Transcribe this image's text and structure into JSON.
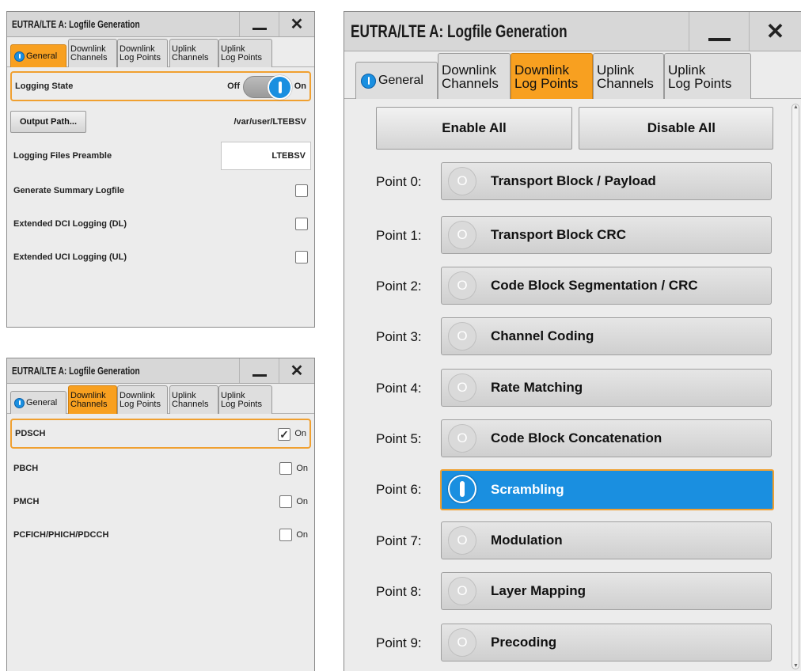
{
  "window_title": "EUTRA/LTE A: Logfile Generation",
  "tabs": [
    {
      "l1": "General",
      "l2": ""
    },
    {
      "l1": "Downlink",
      "l2": "Channels"
    },
    {
      "l1": "Downlink",
      "l2": "Log Points"
    },
    {
      "l1": "Uplink",
      "l2": "Channels"
    },
    {
      "l1": "Uplink",
      "l2": "Log Points"
    }
  ],
  "general": {
    "logging_state_label": "Logging State",
    "off_label": "Off",
    "on_label": "On",
    "logging_state_on": true,
    "output_path_button": "Output Path...",
    "output_path_value": "/var/user/LTEBSV",
    "preamble_label": "Logging Files Preamble",
    "preamble_value": "LTEBSV",
    "checks": [
      {
        "label": "Generate Summary Logfile",
        "checked": false
      },
      {
        "label": "Extended DCI Logging (DL)",
        "checked": false
      },
      {
        "label": "Extended UCI Logging (UL)",
        "checked": false
      }
    ]
  },
  "dl_channels": {
    "items": [
      {
        "label": "PDSCH",
        "on_label": "On",
        "checked": true
      },
      {
        "label": "PBCH",
        "on_label": "On",
        "checked": false
      },
      {
        "label": "PMCH",
        "on_label": "On",
        "checked": false
      },
      {
        "label": "PCFICH/PHICH/PDCCH",
        "on_label": "On",
        "checked": false
      }
    ]
  },
  "dl_log_points": {
    "enable_all": "Enable All",
    "disable_all": "Disable All",
    "points": [
      {
        "label": "Point 0:",
        "name": "Transport Block / Payload",
        "on": false
      },
      {
        "label": "Point 1:",
        "name": "Transport Block CRC",
        "on": false
      },
      {
        "label": "Point 2:",
        "name": "Code Block Segmentation / CRC",
        "on": false
      },
      {
        "label": "Point 3:",
        "name": "Channel Coding",
        "on": false
      },
      {
        "label": "Point 4:",
        "name": "Rate Matching",
        "on": false
      },
      {
        "label": "Point 5:",
        "name": "Code Block Concatenation",
        "on": false
      },
      {
        "label": "Point 6:",
        "name": "Scrambling",
        "on": true
      },
      {
        "label": "Point 7:",
        "name": "Modulation",
        "on": false
      },
      {
        "label": "Point 8:",
        "name": "Layer Mapping",
        "on": false
      },
      {
        "label": "Point 9:",
        "name": "Precoding",
        "on": false
      }
    ]
  },
  "colors": {
    "accent_orange": "#f8a020",
    "active_blue": "#1a8fe0"
  },
  "icons": {
    "minimize": "minimize-icon",
    "close": "close-icon",
    "state": "power-indicator-icon",
    "check": "checkmark-icon"
  }
}
